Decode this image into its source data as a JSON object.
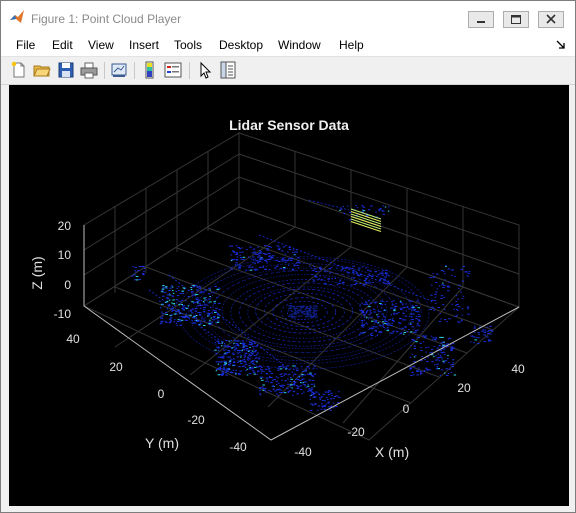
{
  "window": {
    "title": "Figure 1: Point Cloud Player"
  },
  "menu": [
    "File",
    "Edit",
    "View",
    "Insert",
    "Tools",
    "Desktop",
    "Window",
    "Help"
  ],
  "toolbar": {
    "icons": [
      "new-figure-icon",
      "open-file-icon",
      "save-icon",
      "print-icon",
      "link-plot-icon",
      "insert-colorbar-icon",
      "insert-legend-icon",
      "edit-plot-icon",
      "property-inspector-icon"
    ]
  },
  "plot": {
    "title": "Lidar Sensor Data",
    "xlabel": "X (m)",
    "ylabel": "Y (m)",
    "zlabel": "Z (m)",
    "x_ticks": [
      "-40",
      "-20",
      "0",
      "20",
      "40"
    ],
    "y_ticks": [
      "40",
      "20",
      "0",
      "-20",
      "-40"
    ],
    "z_ticks": [
      "20",
      "10",
      "0",
      "-10"
    ],
    "colors": {
      "background": "#000000",
      "points_primary": "#1a2fe0",
      "points_highlight": "#2fd6e0",
      "points_hot": "#e8f060",
      "grid": "#3a3a3a"
    }
  }
}
